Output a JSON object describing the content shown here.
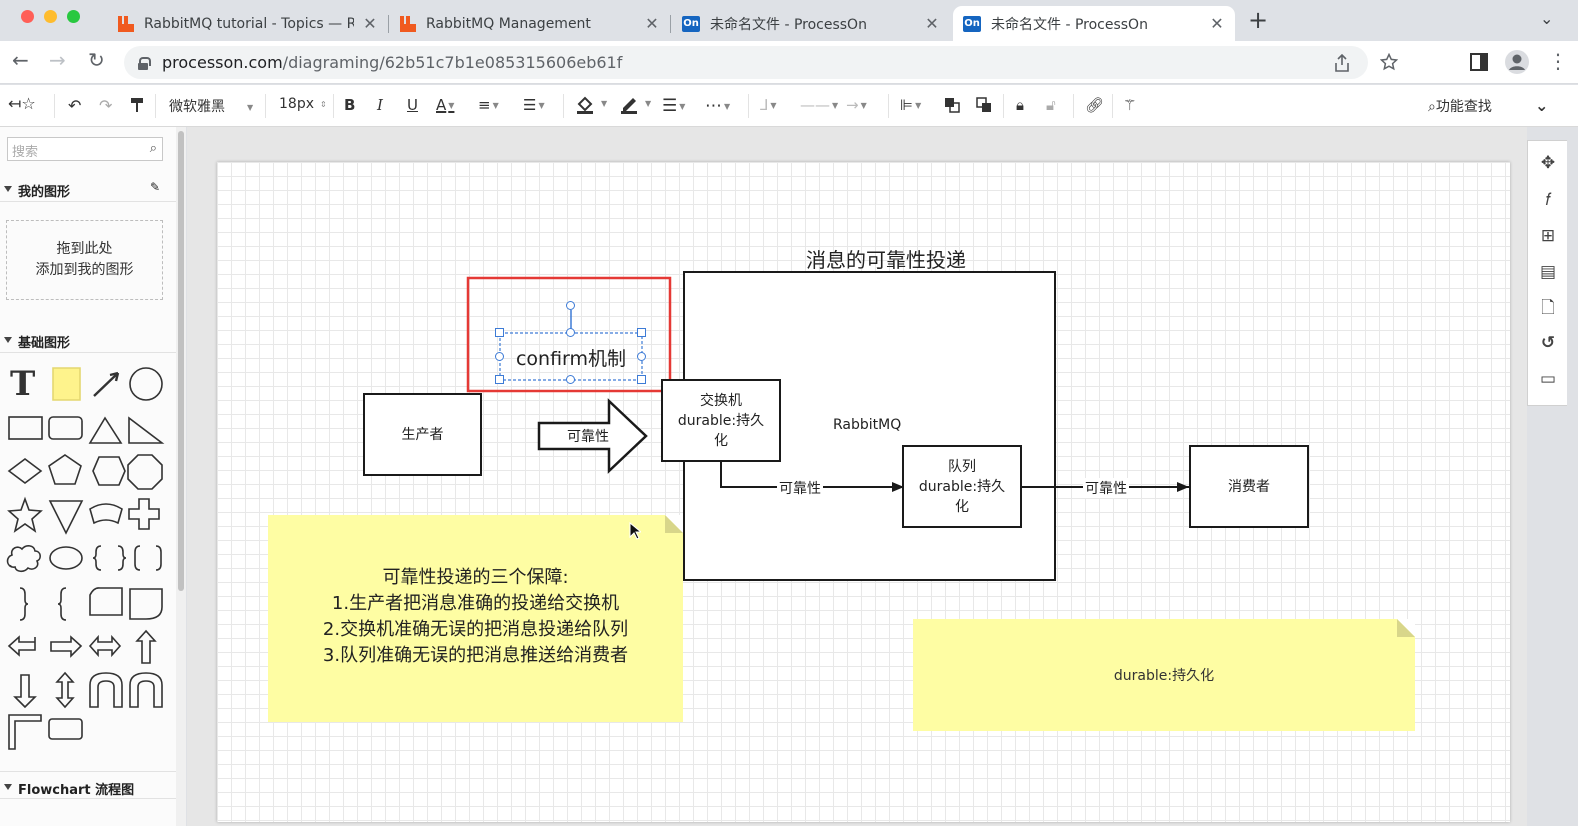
{
  "browser": {
    "tabs": [
      {
        "title": "RabbitMQ tutorial - Topics — R",
        "icon": "rabbitmq-icon",
        "active": false
      },
      {
        "title": "RabbitMQ Management",
        "icon": "rabbitmq-icon",
        "active": false
      },
      {
        "title": "未命名文件 - ProcessOn",
        "icon": "processon-icon",
        "active": false
      },
      {
        "title": "未命名文件 - ProcessOn",
        "icon": "processon-icon",
        "active": true
      }
    ],
    "favicon_on": "On",
    "new_tab": "+",
    "tab_menu": "⌄",
    "url_host": "processon.com",
    "url_path": "/diagraming/62b51c7b1e085315606eb61f"
  },
  "toolbar": {
    "font_family": "微软雅黑",
    "font_size": "18px",
    "bold": "B",
    "italic": "I",
    "underline": "U",
    "font_color": "A",
    "feature_search": "功能查找"
  },
  "sidebar": {
    "search_placeholder": "搜索",
    "my_shapes_title": "我的图形",
    "drop_line1": "拖到此处",
    "drop_line2": "添加到我的图形",
    "basic_shapes_title": "基础图形",
    "text_tool": "T",
    "flowchart_title": "Flowchart 流程图"
  },
  "diagram": {
    "title": "消息的可靠性投递",
    "confirm_label": "confirm机制",
    "producer": "生产者",
    "arrow_label": "可靠性",
    "exchange": "交换机\ndurable:持久\n化",
    "rabbitmq_label": "RabbitMQ",
    "edge1_label": "可靠性",
    "queue": "队列\ndurable:持久\n化",
    "edge2_label": "可靠性",
    "consumer": "消费者",
    "note1": "可靠性投递的三个保障:\n1.生产者把消息准确的投递给交换机\n2.交换机准确无误的把消息投递给队列\n3.队列准确无误的把消息推送给消费者",
    "note2": "durable:持久化"
  },
  "colors": {
    "highlight_red": "#e53935",
    "selection_blue": "#3d7bd6",
    "note_yellow": "#fefda3",
    "rabbitmq_orange": "#f05a1f",
    "processon_blue": "#1565c0"
  }
}
